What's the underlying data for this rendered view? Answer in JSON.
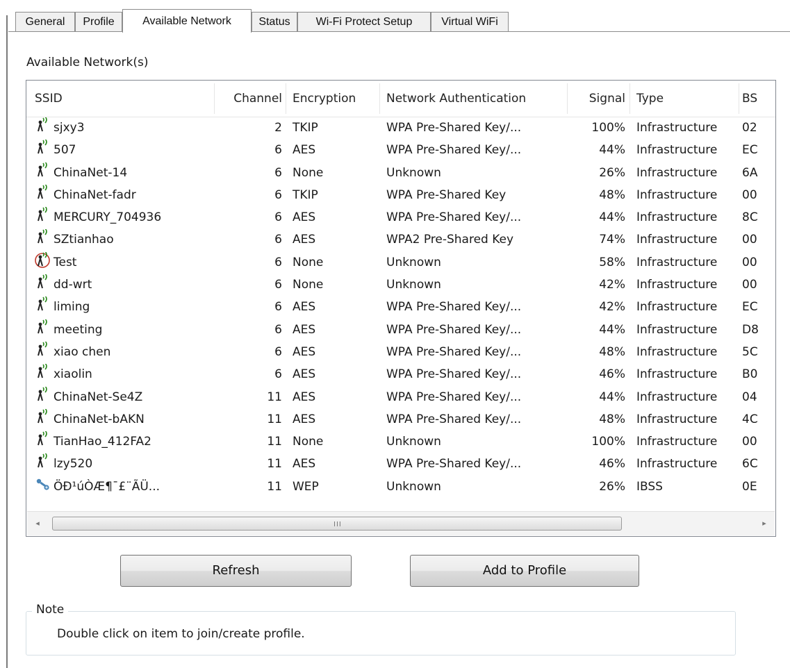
{
  "tabs": [
    {
      "label": "General",
      "active": false
    },
    {
      "label": "Profile",
      "active": false
    },
    {
      "label": "Available Network",
      "active": true
    },
    {
      "label": "Status",
      "active": false
    },
    {
      "label": "Wi-Fi Protect Setup",
      "active": false
    },
    {
      "label": "Virtual WiFi",
      "active": false
    }
  ],
  "panel": {
    "title": "Available Network(s)"
  },
  "table": {
    "columns": {
      "ssid": "SSID",
      "channel": "Channel",
      "encryption": "Encryption",
      "auth": "Network Authentication",
      "signal": "Signal",
      "type": "Type",
      "bssid": "BS"
    },
    "rows": [
      {
        "icon": "wifi-signal-icon",
        "ssid": "sjxy3",
        "channel": "2",
        "encryption": "TKIP",
        "auth": "WPA Pre-Shared Key/...",
        "signal": "100%",
        "type": "Infrastructure",
        "bssid": "02"
      },
      {
        "icon": "wifi-signal-icon",
        "ssid": "507",
        "channel": "6",
        "encryption": "AES",
        "auth": "WPA Pre-Shared Key/...",
        "signal": "44%",
        "type": "Infrastructure",
        "bssid": "EC"
      },
      {
        "icon": "wifi-signal-icon",
        "ssid": "ChinaNet-14",
        "channel": "6",
        "encryption": "None",
        "auth": "Unknown",
        "signal": "26%",
        "type": "Infrastructure",
        "bssid": "6A"
      },
      {
        "icon": "wifi-signal-icon",
        "ssid": "ChinaNet-fadr",
        "channel": "6",
        "encryption": "TKIP",
        "auth": "WPA Pre-Shared Key",
        "signal": "48%",
        "type": "Infrastructure",
        "bssid": "00"
      },
      {
        "icon": "wifi-signal-icon",
        "ssid": "MERCURY_704936",
        "channel": "6",
        "encryption": "AES",
        "auth": "WPA Pre-Shared Key/...",
        "signal": "44%",
        "type": "Infrastructure",
        "bssid": "8C"
      },
      {
        "icon": "wifi-signal-icon",
        "ssid": "SZtianhao",
        "channel": "6",
        "encryption": "AES",
        "auth": "WPA2 Pre-Shared Key",
        "signal": "74%",
        "type": "Infrastructure",
        "bssid": "00"
      },
      {
        "icon": "wifi-connected-icon",
        "ssid": "Test",
        "channel": "6",
        "encryption": "None",
        "auth": "Unknown",
        "signal": "58%",
        "type": "Infrastructure",
        "bssid": "00"
      },
      {
        "icon": "wifi-signal-icon",
        "ssid": "dd-wrt",
        "channel": "6",
        "encryption": "None",
        "auth": "Unknown",
        "signal": "42%",
        "type": "Infrastructure",
        "bssid": "00"
      },
      {
        "icon": "wifi-signal-icon",
        "ssid": "liming",
        "channel": "6",
        "encryption": "AES",
        "auth": "WPA Pre-Shared Key/...",
        "signal": "42%",
        "type": "Infrastructure",
        "bssid": "EC"
      },
      {
        "icon": "wifi-signal-icon",
        "ssid": "meeting",
        "channel": "6",
        "encryption": "AES",
        "auth": "WPA Pre-Shared Key/...",
        "signal": "44%",
        "type": "Infrastructure",
        "bssid": "D8"
      },
      {
        "icon": "wifi-signal-icon",
        "ssid": "xiao chen",
        "channel": "6",
        "encryption": "AES",
        "auth": "WPA Pre-Shared Key/...",
        "signal": "48%",
        "type": "Infrastructure",
        "bssid": "5C"
      },
      {
        "icon": "wifi-signal-icon",
        "ssid": "xiaolin",
        "channel": "6",
        "encryption": "AES",
        "auth": "WPA Pre-Shared Key/...",
        "signal": "46%",
        "type": "Infrastructure",
        "bssid": "B0"
      },
      {
        "icon": "wifi-signal-icon",
        "ssid": "ChinaNet-Se4Z",
        "channel": "11",
        "encryption": "AES",
        "auth": "WPA Pre-Shared Key/...",
        "signal": "44%",
        "type": "Infrastructure",
        "bssid": "04"
      },
      {
        "icon": "wifi-signal-icon",
        "ssid": "ChinaNet-bAKN",
        "channel": "11",
        "encryption": "AES",
        "auth": "WPA Pre-Shared Key/...",
        "signal": "48%",
        "type": "Infrastructure",
        "bssid": "4C"
      },
      {
        "icon": "wifi-signal-icon",
        "ssid": "TianHao_412FA2",
        "channel": "11",
        "encryption": "None",
        "auth": "Unknown",
        "signal": "100%",
        "type": "Infrastructure",
        "bssid": "00"
      },
      {
        "icon": "wifi-signal-icon",
        "ssid": "lzy520",
        "channel": "11",
        "encryption": "AES",
        "auth": "WPA Pre-Shared Key/...",
        "signal": "46%",
        "type": "Infrastructure",
        "bssid": "6C"
      },
      {
        "icon": "adhoc-network-icon",
        "ssid": "ÖÐ¹úÒÆ¶¯£¨ÃÜ...",
        "channel": "11",
        "encryption": "WEP",
        "auth": "Unknown",
        "signal": "26%",
        "type": "IBSS",
        "bssid": "0E"
      }
    ]
  },
  "scrollbar": {
    "grip": "III",
    "left_arrow": "◂",
    "right_arrow": "▸"
  },
  "buttons": {
    "refresh": "Refresh",
    "add_to_profile": "Add to Profile"
  },
  "note": {
    "label": "Note",
    "text": "Double click on item to join/create profile."
  },
  "colors": {
    "icon_green": "#2c8a1e",
    "icon_dark": "#222222",
    "connected_ring": "#c0392b",
    "adhoc_blue": "#4a86b8"
  }
}
